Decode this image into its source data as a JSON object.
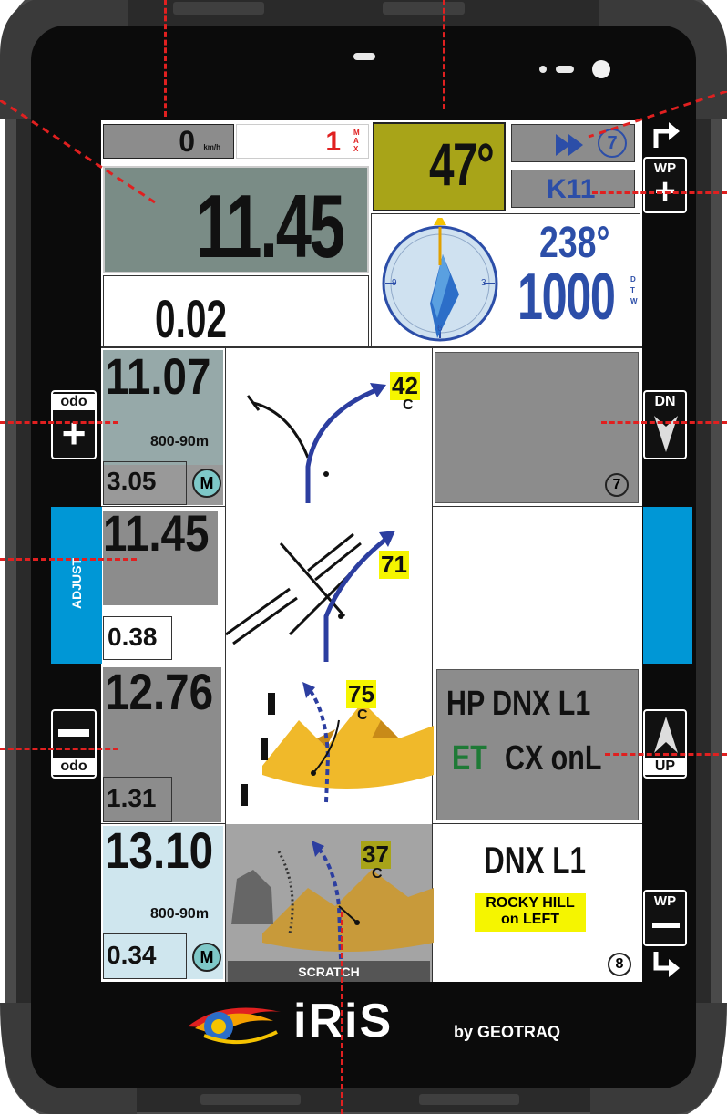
{
  "top_bar": {
    "speed_value": "0",
    "speed_unit": "km/h",
    "max_value": "1",
    "max_label": "MAX",
    "heading_value": "47°",
    "waypoint_counter": "7",
    "waypoint_name": "K11"
  },
  "odometer": {
    "main_value": "11.45",
    "partial_value": "0.02"
  },
  "navigation": {
    "bearing_value": "238°",
    "distance_value": "1000",
    "distance_label": "DTW",
    "compass_marks": [
      "9",
      "3",
      "6"
    ]
  },
  "roadbook": {
    "rows": [
      {
        "total": "11.07",
        "note": "800-90m",
        "partial": "3.05",
        "badge": "M",
        "caution": "42",
        "caution_sub": "C",
        "right_badge": "7",
        "right_text": []
      },
      {
        "total": "11.45",
        "note": "",
        "partial": "0.38",
        "badge": "",
        "caution": "71",
        "caution_sub": "",
        "right_badge": "",
        "right_text": []
      },
      {
        "total": "12.76",
        "note": "",
        "partial": "1.31",
        "badge": "",
        "caution": "75",
        "caution_sub": "C",
        "right_badge": "",
        "right_text": [
          "HP DNX L1",
          "ET",
          "CX onL"
        ]
      },
      {
        "total": "13.10",
        "note": "800-90m",
        "partial": "0.34",
        "badge": "M",
        "caution": "37",
        "caution_sub": "C",
        "right_badge": "8",
        "right_text": [
          "DNX L1",
          "ROCKY HILL",
          "on LEFT"
        ],
        "footer": "SCRATCH"
      }
    ]
  },
  "side_buttons": {
    "odo_plus_label": "odo",
    "adjust_label": "ADJUST",
    "odo_minus_label": "odo",
    "dn_label": "DN",
    "up_label": "UP",
    "wp_plus_label": "WP",
    "wp_minus_label": "WP"
  },
  "brand": {
    "logo_text": "iRiS",
    "by_text": "by GEOTRAQ"
  },
  "colors": {
    "accent_blue": "#0097d6",
    "highlight_yellow": "#f5f500",
    "heading_olive": "#a8a418",
    "alert_red": "#e02020",
    "nav_blue": "#2c4ea8"
  }
}
